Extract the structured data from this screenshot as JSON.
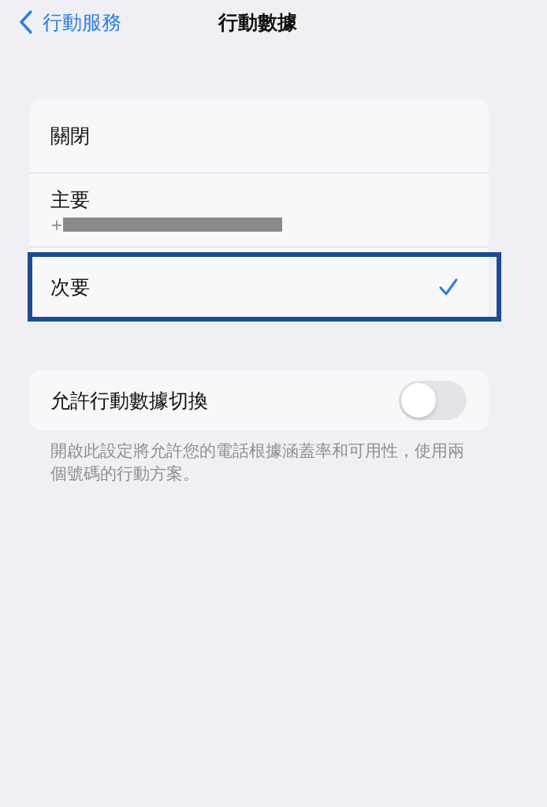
{
  "nav": {
    "back_label": "行動服務",
    "title": "行動數據"
  },
  "options": [
    {
      "label": "關閉",
      "selected": false,
      "highlighted": false
    },
    {
      "label": "主要",
      "number": "+",
      "redacted": true,
      "selected": false,
      "highlighted": false
    },
    {
      "label": "次要",
      "selected": true,
      "highlighted": true
    }
  ],
  "switch_row": {
    "label": "允許行動數據切換",
    "on": false
  },
  "footer": "開啟此設定將允許您的電話根據涵蓋率和可用性，使用兩個號碼的行動方案。"
}
